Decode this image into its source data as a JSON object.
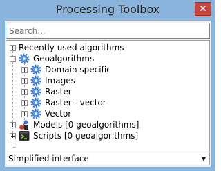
{
  "window": {
    "title": "Processing Toolbox",
    "close_label": "✕"
  },
  "search": {
    "placeholder": "Search..."
  },
  "tree": {
    "recent": {
      "label": "Recently used algorithms"
    },
    "geoalgorithms": {
      "label": "Geoalgorithms",
      "icon": "gear-icon",
      "children": [
        {
          "label": "Domain specific",
          "icon": "gear-icon"
        },
        {
          "label": "Images",
          "icon": "gear-icon"
        },
        {
          "label": "Raster",
          "icon": "gear-icon"
        },
        {
          "label": "Raster - vector",
          "icon": "gear-icon"
        },
        {
          "label": "Vector",
          "icon": "gear-icon"
        }
      ]
    },
    "models": {
      "label": "Models [0 geoalgorithms]",
      "icon": "model-icon"
    },
    "scripts": {
      "label": "Scripts [0 geoalgorithms]",
      "icon": "script-icon"
    }
  },
  "interface_mode": {
    "selected": "Simplified interface",
    "arrow": "▼"
  },
  "colors": {
    "window_frame": "#8ab4dc",
    "close_button": "#c7453f",
    "gear": "#3b7dd8",
    "focus_border": "#4a90d9"
  }
}
